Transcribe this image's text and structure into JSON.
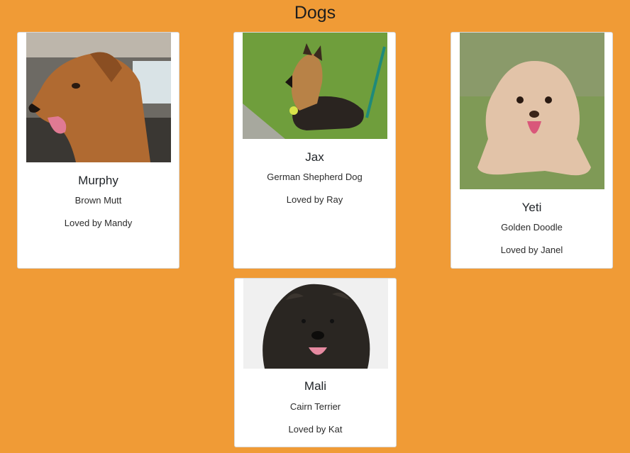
{
  "header": {
    "title": "Dogs"
  },
  "dogs": [
    {
      "name": "Murphy",
      "breed": "Brown Mutt",
      "owner": "Loved by Mandy"
    },
    {
      "name": "Jax",
      "breed": "German Shepherd Dog",
      "owner": "Loved by Ray"
    },
    {
      "name": "Yeti",
      "breed": "Golden Doodle",
      "owner": "Loved by Janel"
    },
    {
      "name": "Mali",
      "breed": "Cairn Terrier",
      "owner": "Loved by Kat"
    }
  ],
  "colors": {
    "background": "#f09b36",
    "card": "#ffffff"
  }
}
